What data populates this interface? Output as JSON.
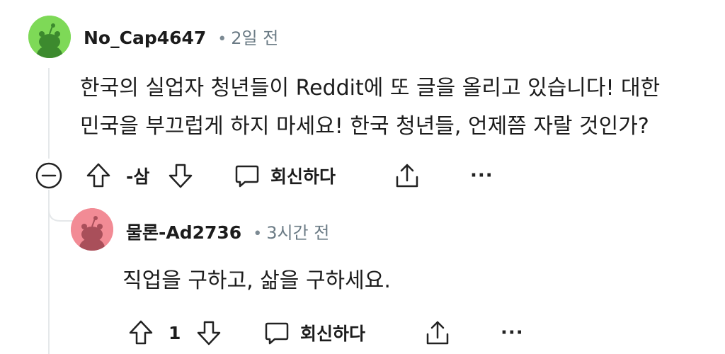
{
  "comment": {
    "username": "No_Cap4647",
    "dot": "•",
    "time": "2일 전",
    "text_line1": "한국의 실업자 청년들이 Reddit에 또 글을 올리고 있습니다! 대한",
    "text_line2": "민국을 부끄럽게 하지 마세요! 한국 청년들, 언제쯤 자랄 것인가?",
    "vote_count": "-삼",
    "reply_label": "회신하다",
    "more": "···",
    "avatar_color": "#7ed957"
  },
  "reply": {
    "username": "물론-Ad2736",
    "dot": "•",
    "time": "3시간 전",
    "text": "직업을 구하고, 삶을 구하세요.",
    "vote_count": "1",
    "reply_label": "회신하다",
    "more": "···",
    "avatar_color": "#f28b95"
  },
  "icons": {
    "collapse": "collapse-icon",
    "upvote": "upvote-icon",
    "downvote": "downvote-icon",
    "reply": "comment-bubble-icon",
    "share": "share-icon",
    "more": "more-options-icon"
  }
}
